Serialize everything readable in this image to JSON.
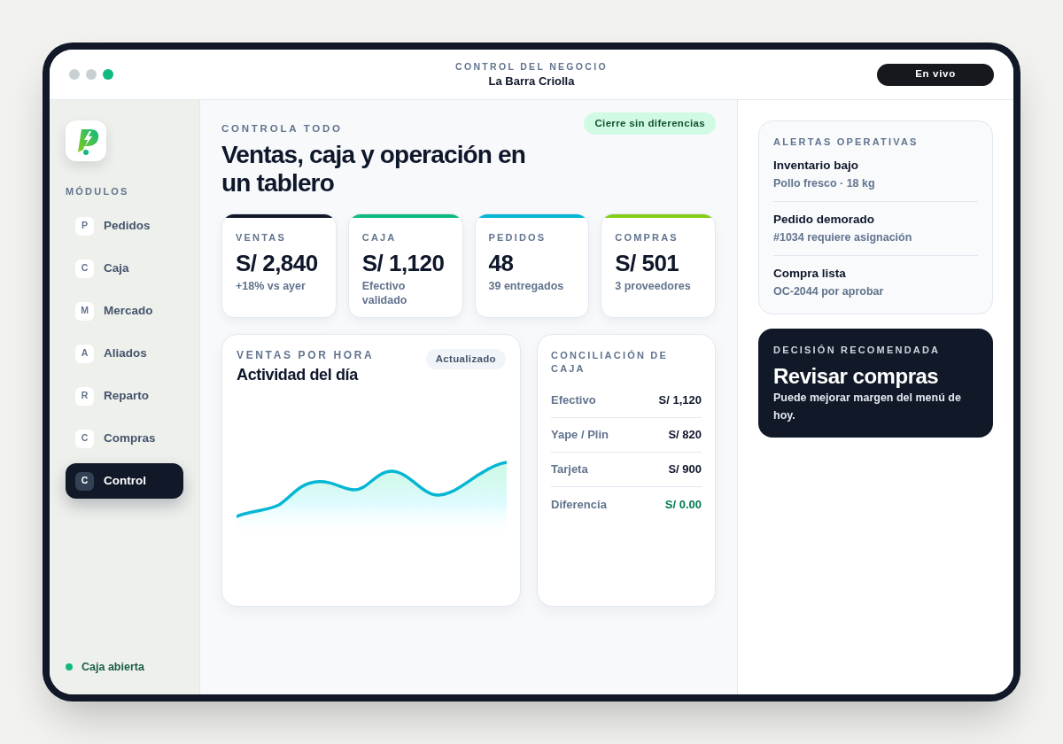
{
  "window": {
    "dots": [
      {
        "color": "#c8d0d4"
      },
      {
        "color": "#c8d0d4"
      },
      {
        "color": "#10b981"
      }
    ],
    "eyebrow": "CONTROL DEL NEGOCIO",
    "title": "La Barra Criolla",
    "live_label": "En vivo"
  },
  "sidebar": {
    "section_label": "MÓDULOS",
    "items": [
      {
        "initial": "P",
        "label": "Pedidos",
        "selected": false
      },
      {
        "initial": "C",
        "label": "Caja",
        "selected": false
      },
      {
        "initial": "M",
        "label": "Mercado",
        "selected": false
      },
      {
        "initial": "A",
        "label": "Aliados",
        "selected": false
      },
      {
        "initial": "R",
        "label": "Reparto",
        "selected": false
      },
      {
        "initial": "C",
        "label": "Compras",
        "selected": false
      },
      {
        "initial": "C",
        "label": "Control",
        "selected": true
      }
    ],
    "status": "Caja abierta"
  },
  "main": {
    "eyebrow": "CONTROLA TODO",
    "heading": "Ventas, caja y operación en un tablero",
    "badge": "Cierre sin diferencias",
    "stats": [
      {
        "label": "VENTAS",
        "value": "S/ 2,840",
        "note": "+18% vs ayer",
        "color": "#111827"
      },
      {
        "label": "CAJA",
        "value": "S/ 1,120",
        "note": "Efectivo validado",
        "color": "#10b981"
      },
      {
        "label": "PEDIDOS",
        "value": "48",
        "note": "39 entregados",
        "color": "#06b6d4"
      },
      {
        "label": "COMPRAS",
        "value": "S/ 501",
        "note": "3 proveedores",
        "color": "#84cc16"
      }
    ],
    "sales_chart": {
      "eyebrow": "VENTAS POR HORA",
      "title": "Actividad del día",
      "badge": "Actualizado"
    },
    "reconciliation": {
      "title": "CONCILIACIÓN DE CAJA",
      "rows": [
        {
          "label": "Efectivo",
          "amount": "S/ 1,120",
          "kind": "amount"
        },
        {
          "label": "Yape / Plin",
          "amount": "S/ 820",
          "kind": "amount"
        },
        {
          "label": "Tarjeta",
          "amount": "S/ 900",
          "kind": "amount"
        },
        {
          "label": "Diferencia",
          "amount": "S/ 0.00",
          "kind": "balance"
        }
      ]
    }
  },
  "right_panel": {
    "alerts": {
      "title": "ALERTAS OPERATIVAS",
      "items": [
        {
          "title": "Inventario bajo",
          "detail": "Pollo fresco · 18 kg"
        },
        {
          "title": "Pedido demorado",
          "detail": "#1034 requiere asignación"
        },
        {
          "title": "Compra lista",
          "detail": "OC-2044 por aprobar"
        }
      ]
    },
    "recommendation": {
      "eyebrow": "DECISIÓN RECOMENDADA",
      "title": "Revisar compras",
      "text": "Puede mejorar margen del menú de hoy."
    }
  }
}
